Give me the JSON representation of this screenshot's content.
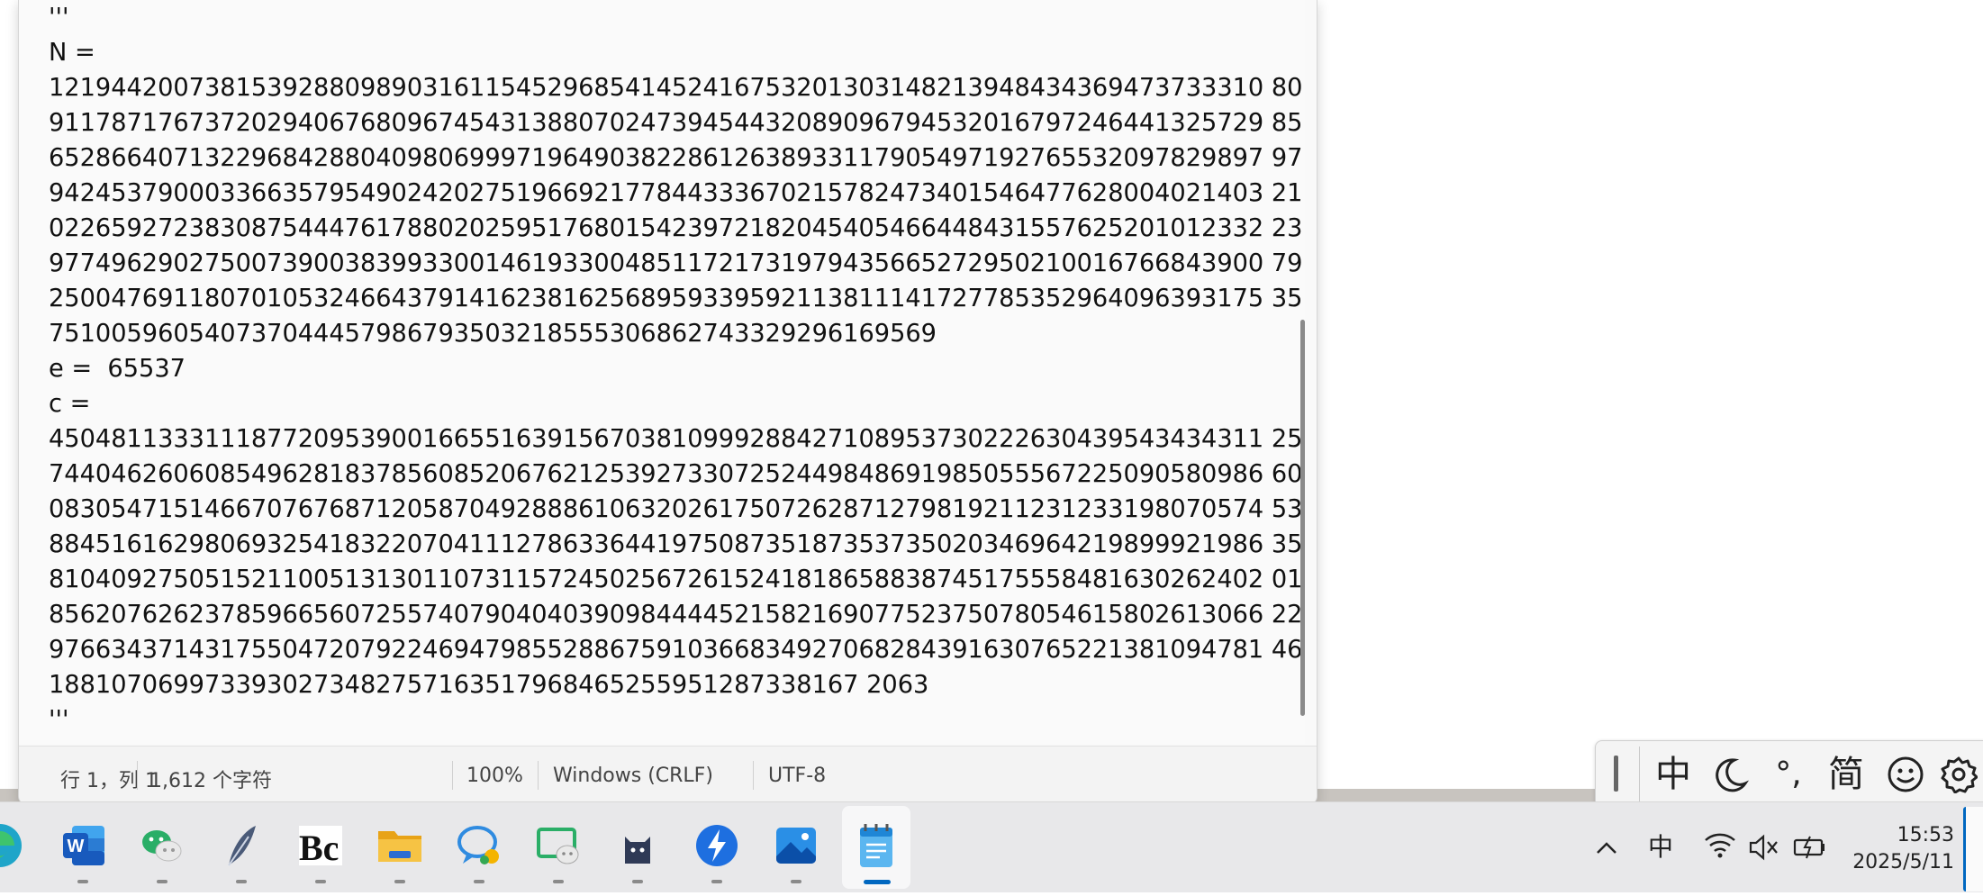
{
  "editor": {
    "text": "'''\nN = \n121944200738153928809890316115452968541452416753201303148213948434369473733310 80\n911787176737202940676809674543138807024739454432089096794532016797246441325729 85\n652866407132296842880409806999719649038228612638933117905497192765532097829897 97\n942453790003366357954902420275196692177844333670215782473401546477628004021403 21\n022659272383087544476178802025951768015423972182045405466448431557625201012332 23\n977496290275007390038399330014619330048511721731979435665272950210016766843900 79\n250047691180701053246643791416238162568959339592113811141727785352964096393175 35\n751005960540737044457986793503218555306862743329296169569\ne =  65537\nc = \n450481133311187720953900166551639156703810999288427108953730222630439543434311 25\n744046260608549628183785608520676212539273307252449848691985055567225090580986 60\n083054715146670767687120587049288861063202617507262871279819211231233198070574 53\n884516162980693254183220704111278633644197508735187353735020346964219899921986 35\n810409275051521100513130110731157245025672615241818658838745175558481630262402 01\n856207626237859665607255740790404039098444452158216907752375078054615802613066 22\n976634371431755047207922469479855288675910366834927068284391630765221381094781 46\n1881070699733930273482757163517968465255951287338167 2063\n'''",
    "scrollbar_position": 0.7
  },
  "statusbar": {
    "position": "行 1，列 1",
    "chars": "1,612 个字符",
    "zoom": "100%",
    "line_ending": "Windows (CRLF)",
    "encoding": "UTF-8"
  },
  "ime": {
    "mode": "中",
    "moon_icon": "moon-icon",
    "punct": "°,",
    "simplified": "简",
    "emoji_icon": "smiley-icon",
    "settings_icon": "gear-icon"
  },
  "taskbar": {
    "apps": [
      "edge-icon",
      "word-icon",
      "wechat-icon",
      "feather-icon",
      "bc-icon",
      "file-explorer-icon",
      "chat-icon",
      "wechat-window-icon",
      "cat-icon",
      "thunder-icon",
      "photos-icon",
      "notepad-icon"
    ],
    "word_letter": "W",
    "bc_letter": "Bc",
    "tray_ime": "中",
    "time": "15:53",
    "date": "2025/5/11"
  },
  "colors": {
    "accent": "#0067c0",
    "word": "#185abd",
    "wechat": "#2aae67",
    "folder": "#f0b429"
  }
}
